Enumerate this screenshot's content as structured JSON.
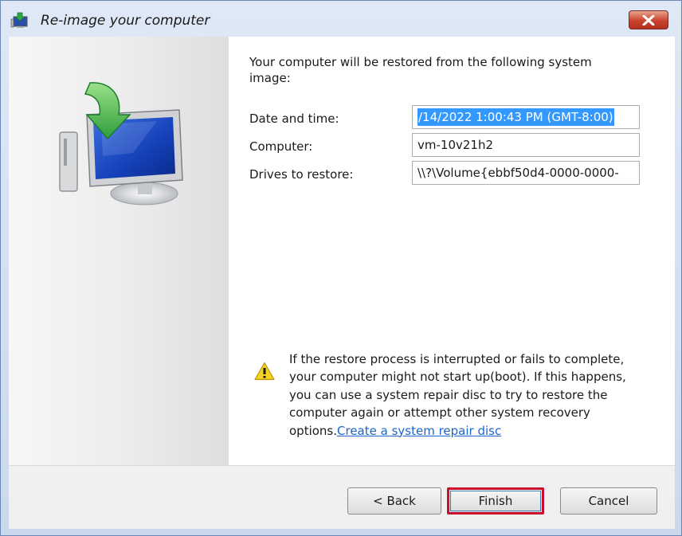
{
  "window": {
    "title": "Re-image your computer",
    "close_icon": "close-icon"
  },
  "intro_text": "Your computer will be restored from the following system image:",
  "details": {
    "date_label": "Date and time:",
    "date_value": "/14/2022 1:00:43 PM (GMT-8:00)",
    "computer_label": "Computer:",
    "computer_value": "vm-10v21h2",
    "drives_label": "Drives to restore:",
    "drives_value": "\\\\?\\Volume{ebbf50d4-0000-0000-"
  },
  "warning": {
    "icon": "warning-icon",
    "text": "If the restore process is interrupted or fails to complete, your computer might not start up(boot). If this happens, you can use a system repair disc to try to restore the computer again or attempt other system recovery options.",
    "link": "Create a system repair disc"
  },
  "buttons": {
    "back": "< Back",
    "finish": "Finish",
    "cancel": "Cancel"
  },
  "colors": {
    "accent": "#3399ff",
    "link": "#1c66c9",
    "highlight_border": "#c8102e",
    "close_button": "#c9432e"
  }
}
